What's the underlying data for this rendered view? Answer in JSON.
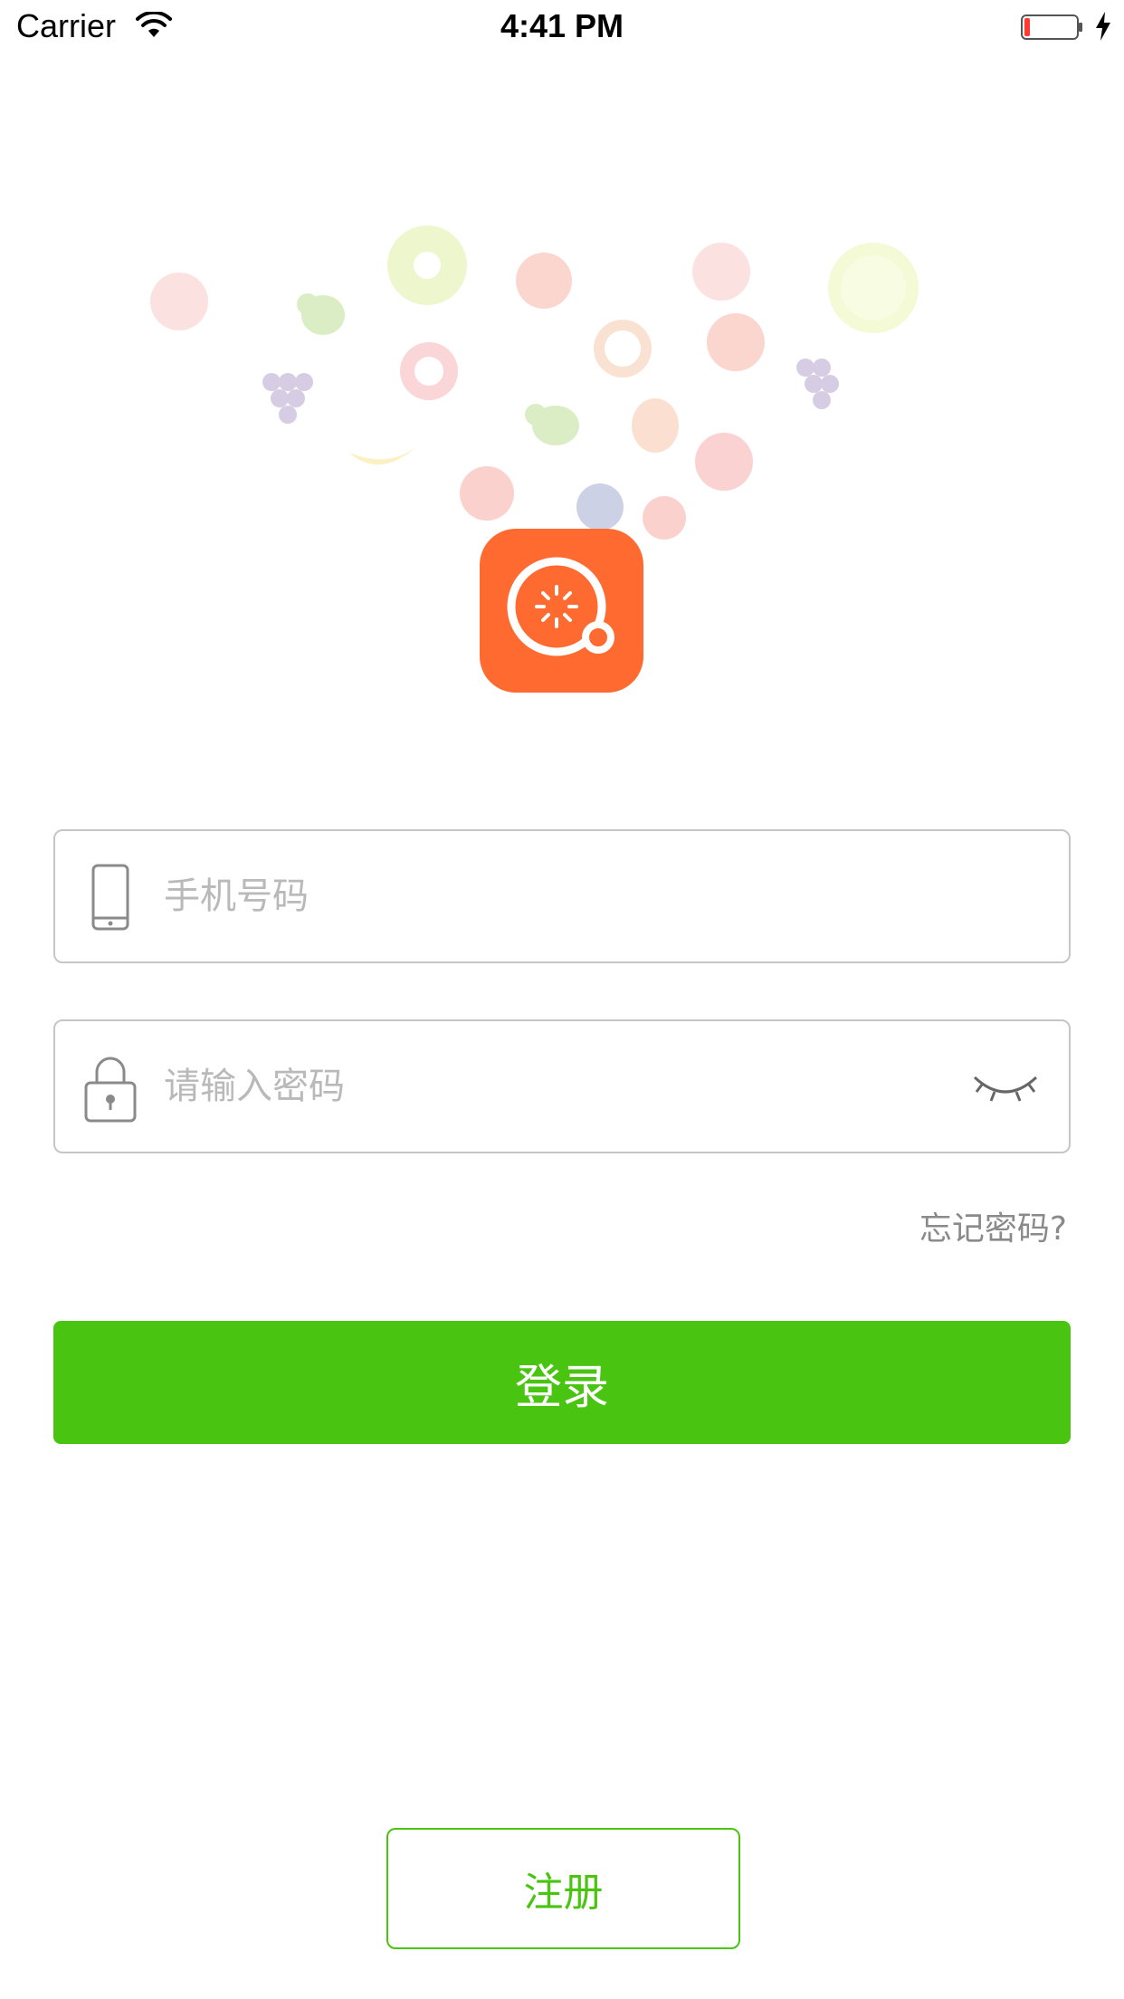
{
  "status_bar": {
    "carrier": "Carrier",
    "time": "4:41 PM",
    "battery_level_fraction": 0.1,
    "battery_color": "#ff3b30",
    "icons": [
      "wifi-icon",
      "battery-icon",
      "charging-bolt-icon"
    ]
  },
  "branding": {
    "logo_icon": "kiwi-fruit-logo-icon",
    "logo_color": "#ff6a30",
    "background_decoration": "fruit-pattern"
  },
  "login_form": {
    "phone": {
      "icon": "phone-icon",
      "value": "",
      "placeholder": "手机号码"
    },
    "password": {
      "icon": "lock-icon",
      "value": "",
      "placeholder": "请输入密码",
      "toggle_icon": "eye-closed-icon"
    },
    "forgot_label": "忘记密码?",
    "login_label": "登录",
    "register_label": "注册"
  },
  "colors": {
    "accent_green": "#49c411",
    "placeholder_gray": "#b9b9b9",
    "border_gray": "#c6c6c6",
    "link_gray": "#8a8a8a"
  }
}
